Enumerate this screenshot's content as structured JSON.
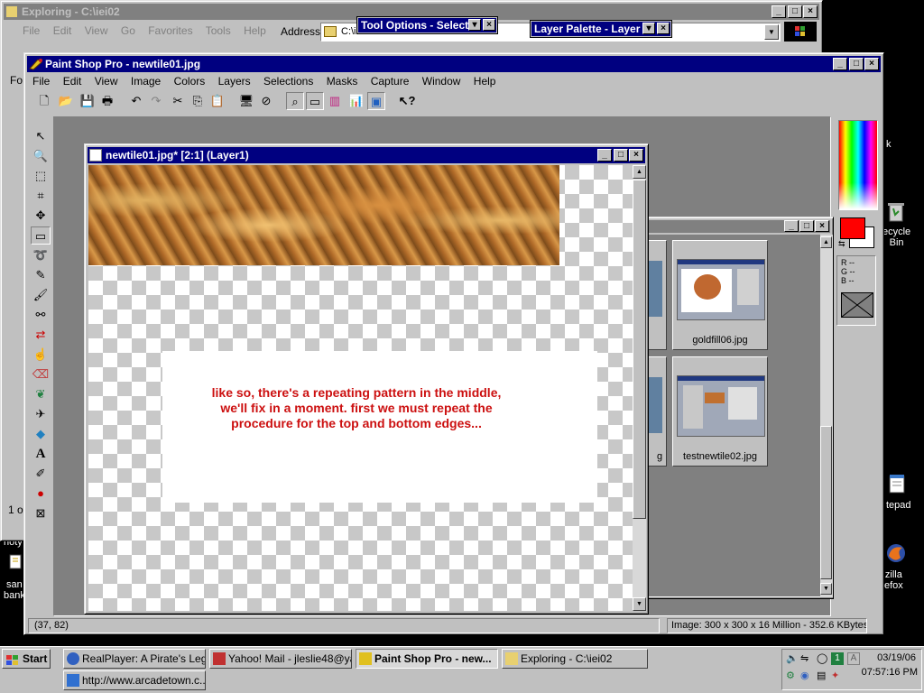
{
  "explorer": {
    "title": "Exploring - C:\\iei02",
    "menu": [
      "File",
      "Edit",
      "View",
      "Go",
      "Favorites",
      "Tools",
      "Help"
    ],
    "address_label": "Address",
    "address_value": "C:\\iei02",
    "left_pane_frag1": "Fo",
    "left_pane_frag2": "1 ol"
  },
  "tool_options": {
    "title": "Tool Options - Select"
  },
  "layer_palette": {
    "title": "Layer Palette - Layer"
  },
  "psp": {
    "title": "Paint Shop Pro - newtile01.jpg",
    "menu": [
      "File",
      "Edit",
      "View",
      "Image",
      "Colors",
      "Layers",
      "Selections",
      "Masks",
      "Capture",
      "Window",
      "Help"
    ],
    "status_coords": "(37, 82)",
    "status_image": "Image:  300 x 300 x 16 Million - 352.6 KBytes",
    "rgb": {
      "r": "R --",
      "g": "G --",
      "b": "B --"
    },
    "colors": {
      "foreground": "#ff0000",
      "background": "#ffffff"
    }
  },
  "image_window": {
    "title": "newtile01.jpg* [2:1] (Layer1)",
    "annotation": {
      "line1": "like so,  there's a repeating pattern in the middle,",
      "line2": "we'll fix in a moment.  first we must repeat the",
      "line3": "procedure for the top and bottom edges..."
    }
  },
  "browser_panel": {
    "thumbs": [
      {
        "name": "goldfill06.jpg"
      },
      {
        "name": "testnewtile02.jpg"
      }
    ],
    "frag_label": "g"
  },
  "desktop": {
    "recycle": "ecycle\nBin",
    "notepad": "tepad",
    "mozilla": "zilla\nefox",
    "left1": "noty",
    "left2": "san\nbank",
    "k_frag": "k"
  },
  "taskbar": {
    "start": "Start",
    "tasks": [
      "RealPlayer: A Pirate's Leg...",
      "Yahoo! Mail - jleslie48@ya...",
      "Paint Shop Pro - new...",
      "Exploring - C:\\iei02",
      "http://www.arcadetown.c..."
    ],
    "date": "03/19/06",
    "time": "07:57:16 PM"
  }
}
